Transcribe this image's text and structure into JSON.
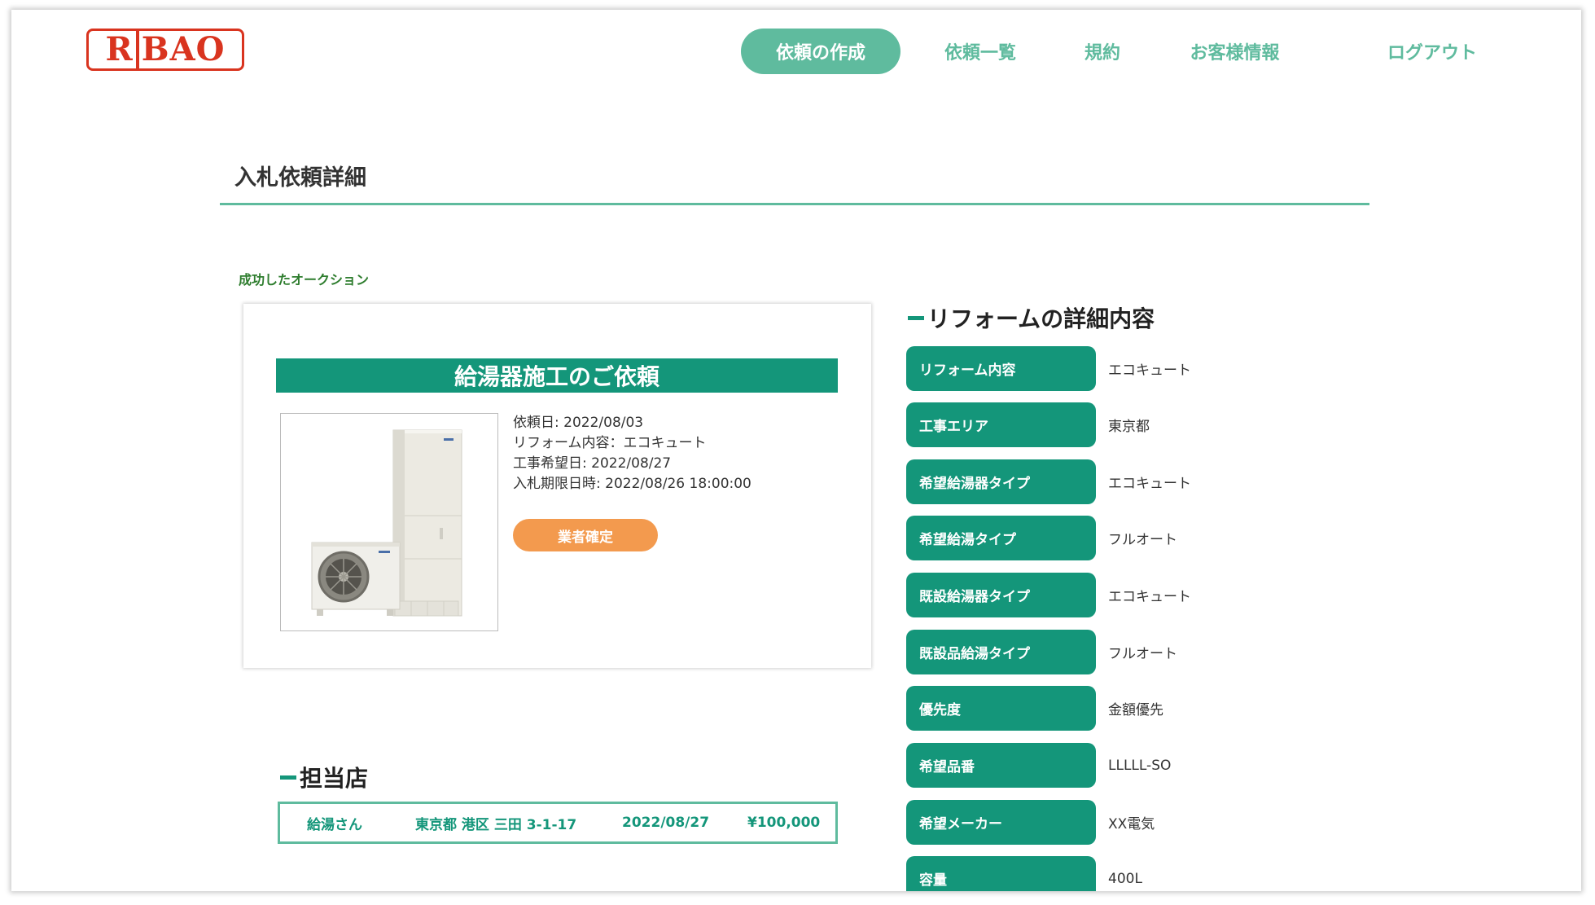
{
  "header": {
    "logo_text_left": "R",
    "logo_text_right": "BAO",
    "nav": [
      {
        "label": "依頼の作成",
        "active": true
      },
      {
        "label": "依頼一覧"
      },
      {
        "label": "規約"
      },
      {
        "label": "お客様情報"
      },
      {
        "label": "ログアウト"
      }
    ]
  },
  "page": {
    "title": "入札依頼詳細",
    "success_message": "成功したオークション"
  },
  "request_card": {
    "banner": "給湯器施工のご依頼",
    "lines": [
      "依頼日: 2022/08/03",
      "リフォーム内容：エコキュート",
      "工事希望日: 2022/08/27",
      "入札期限日時: 2022/08/26 18:00:00"
    ],
    "confirm_button": "業者確定"
  },
  "store": {
    "heading": "担当店",
    "name": "給湯さん",
    "address": "東京都 港区 三田 3-1-17",
    "date": "2022/08/27",
    "price": "¥100,000"
  },
  "details": {
    "heading": "リフォームの詳細内容",
    "rows": [
      {
        "label": "リフォーム内容",
        "value": "エコキュート"
      },
      {
        "label": "工事エリア",
        "value": "東京都"
      },
      {
        "label": "希望給湯器タイプ",
        "value": "エコキュート"
      },
      {
        "label": "希望給湯タイプ",
        "value": "フルオート"
      },
      {
        "label": "既設給湯器タイプ",
        "value": "エコキュート"
      },
      {
        "label": "既設品給湯タイプ",
        "value": "フルオート"
      },
      {
        "label": "優先度",
        "value": "金額優先"
      },
      {
        "label": "希望品番",
        "value": "LLLLL-SO"
      },
      {
        "label": "希望メーカー",
        "value": "XX電気"
      },
      {
        "label": "容量",
        "value": "400L"
      }
    ]
  },
  "colors": {
    "accent": "#14967a",
    "accent_light": "#5fbb9e",
    "logo": "#d9341f",
    "button_orange": "#f39a4e"
  }
}
